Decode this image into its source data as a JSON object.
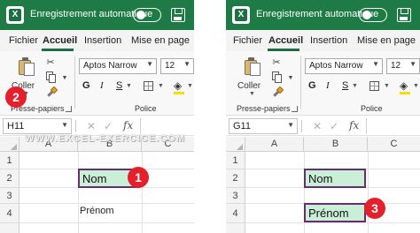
{
  "titlebar": {
    "autosave_label": "Enregistrement automatique"
  },
  "tabs": [
    "Fichier",
    "Accueil",
    "Insertion",
    "Mise en page"
  ],
  "ribbon": {
    "paste_label": "Coller",
    "clipboard_group_label": "Presse-papiers",
    "font_group_label": "Police",
    "font_name": "Aptos Narrow",
    "font_size": "12",
    "bold": "G",
    "italic": "I",
    "underline": "S"
  },
  "formula_bar": {
    "fx_label": "fx"
  },
  "watermark": "WWW.EXCEL-EXERCICE.COM",
  "grid": {
    "columns": [
      "A",
      "B",
      "C"
    ],
    "rows": [
      "1",
      "2",
      "3",
      "4"
    ]
  },
  "left": {
    "namebox": "H11",
    "cell_b2": "Nom",
    "cell_b4": "Prénom",
    "badge_format_painter": "2",
    "badge_cell": "1"
  },
  "right": {
    "namebox": "G11",
    "cell_b2": "Nom",
    "cell_b4": "Prénom",
    "badge_cell": "3"
  },
  "colors": {
    "excel_green": "#1f7b45",
    "selection_fill": "#c9efd6",
    "selection_border": "#6a2c70",
    "badge_red": "#e4202d"
  }
}
